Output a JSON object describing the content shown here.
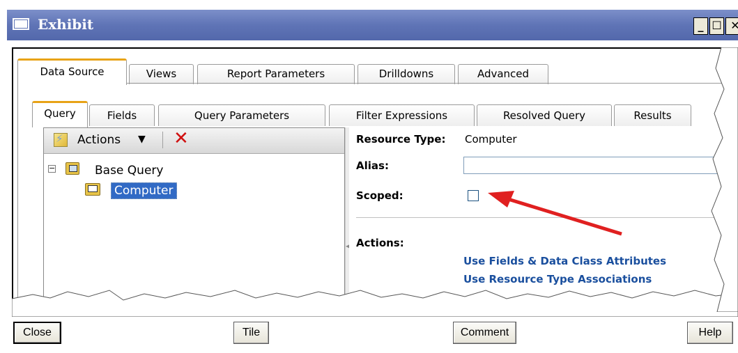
{
  "window": {
    "title": "Exhibit",
    "minimize_glyph": "_",
    "maximize_glyph": "☐",
    "close_glyph": "✕"
  },
  "outer_tabs": [
    {
      "label": "Data Source",
      "active": true
    },
    {
      "label": "Views",
      "active": false
    },
    {
      "label": "Report Parameters",
      "active": false
    },
    {
      "label": "Drilldowns",
      "active": false
    },
    {
      "label": "Advanced",
      "active": false
    }
  ],
  "inner_tabs": [
    {
      "label": "Query",
      "active": true
    },
    {
      "label": "Fields",
      "active": false
    },
    {
      "label": "Query Parameters",
      "active": false
    },
    {
      "label": "Filter Expressions",
      "active": false
    },
    {
      "label": "Resolved Query",
      "active": false
    },
    {
      "label": "Results",
      "active": false
    }
  ],
  "left_pane": {
    "actions_label": "Actions",
    "caret": "▼",
    "delete_glyph": "✕",
    "tree": {
      "expander": "−",
      "root_label": "Base Query",
      "child_label": "Computer"
    }
  },
  "right_pane": {
    "resource_type_label": "Resource Type:",
    "resource_type_value": "Computer",
    "alias_label": "Alias:",
    "alias_value": "",
    "scoped_label": "Scoped:",
    "scoped_checked": false,
    "actions_label": "Actions:",
    "links": [
      "Use Fields & Data Class Attributes",
      "Use Resource Type Associations"
    ]
  },
  "buttons": {
    "close": "Close",
    "tile": "Tile",
    "comment": "Comment",
    "help": "Help"
  },
  "colors": {
    "title_bar": "#5f74b6",
    "active_tab_accent": "#e8a317",
    "selection": "#316ac5",
    "link": "#1a4f9e",
    "annotation_arrow": "#e02020"
  }
}
